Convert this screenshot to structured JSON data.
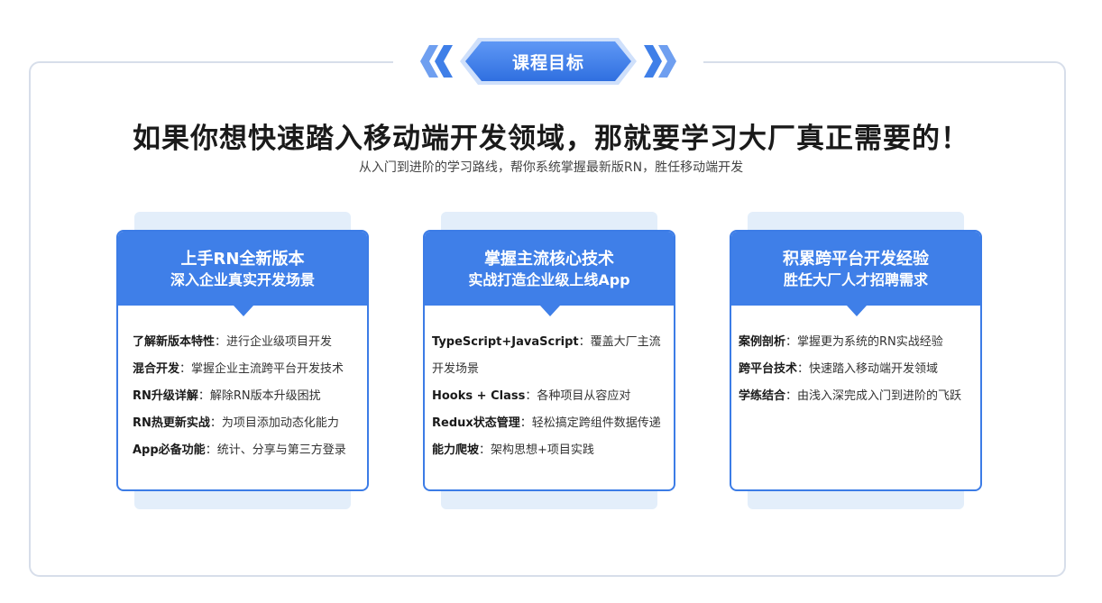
{
  "badge": {
    "label": "课程目标"
  },
  "headline": "如果你想快速踏入移动端开发领域，那就要学习大厂真正需要的！",
  "subline": "从入门到进阶的学习路线，帮你系统掌握最新版RN，胜任移动端开发",
  "colors": {
    "accent": "#3f7fe8",
    "border": "#3c7ce6",
    "card_back": "#e3eefa",
    "frame": "#d7deea"
  },
  "cards": [
    {
      "title": "上手RN全新版本",
      "subtitle": "深入企业真实开发场景",
      "items": [
        {
          "key": "了解新版本特性",
          "value": "：进行企业级项目开发"
        },
        {
          "key": "混合开发",
          "value": "：掌握企业主流跨平台开发技术"
        },
        {
          "key": "RN升级详解",
          "value": "：解除RN版本升级困扰"
        },
        {
          "key": "RN热更新实战",
          "value": "：为项目添加动态化能力"
        },
        {
          "key": "App必备功能",
          "value": "：统计、分享与第三方登录"
        }
      ]
    },
    {
      "title": "掌握主流核心技术",
      "subtitle": "实战打造企业级上线App",
      "items": [
        {
          "key": "TypeScript+JavaScript",
          "value": "：覆盖大厂主流开发场景"
        },
        {
          "key": "Hooks + Class",
          "value": "：各种项目从容应对"
        },
        {
          "key": "Redux状态管理",
          "value": "：轻松搞定跨组件数据传递"
        },
        {
          "key": "能力爬坡",
          "value": "：架构思想+项目实践"
        }
      ]
    },
    {
      "title": "积累跨平台开发经验",
      "subtitle": "胜任大厂人才招聘需求",
      "items": [
        {
          "key": "案例剖析",
          "value": "：掌握更为系统的RN实战经验"
        },
        {
          "key": "跨平台技术",
          "value": "：快速踏入移动端开发领域"
        },
        {
          "key": "学练结合",
          "value": "：由浅入深完成入门到进阶的飞跃"
        }
      ]
    }
  ]
}
